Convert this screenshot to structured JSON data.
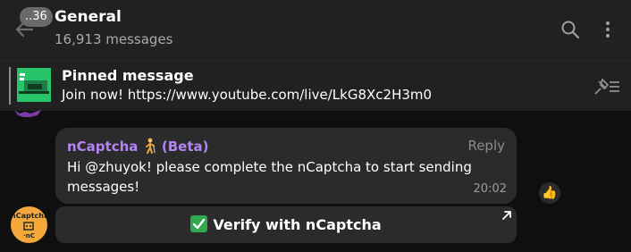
{
  "header": {
    "back_badge": "..36",
    "title": "General",
    "subtitle": "16,913 messages"
  },
  "pinned": {
    "title": "Pinned message",
    "text": "Join now! https://www.youtube.com/live/LkG8Xc2H3m0"
  },
  "message": {
    "sender": "nCaptcha",
    "sender_suffix": "(Beta)",
    "reply_label": "Reply",
    "text": "Hi @zhuyok! please complete the nCaptcha to start sending messages!",
    "time": "20:02",
    "reaction": "👍",
    "button_label": "Verify with nCaptcha"
  },
  "avatar": {
    "top_text": "nCaptcha",
    "bottom_text": "·nC"
  },
  "colors": {
    "background": "#0f0f10",
    "panel": "#212121",
    "bubble": "#2b2b2b",
    "sender": "#b483f5",
    "muted": "#aaaaaa",
    "avatar": "#f4a73a",
    "pin_thumb": "#27c46a"
  },
  "icons": {
    "back": "arrow-left-icon",
    "search": "search-icon",
    "menu": "more-vertical-icon",
    "unpin": "unpin-icon",
    "verify": "check-mark-button-icon",
    "link": "external-arrow-icon",
    "sender_emoji": "person-with-cane-emoji"
  }
}
